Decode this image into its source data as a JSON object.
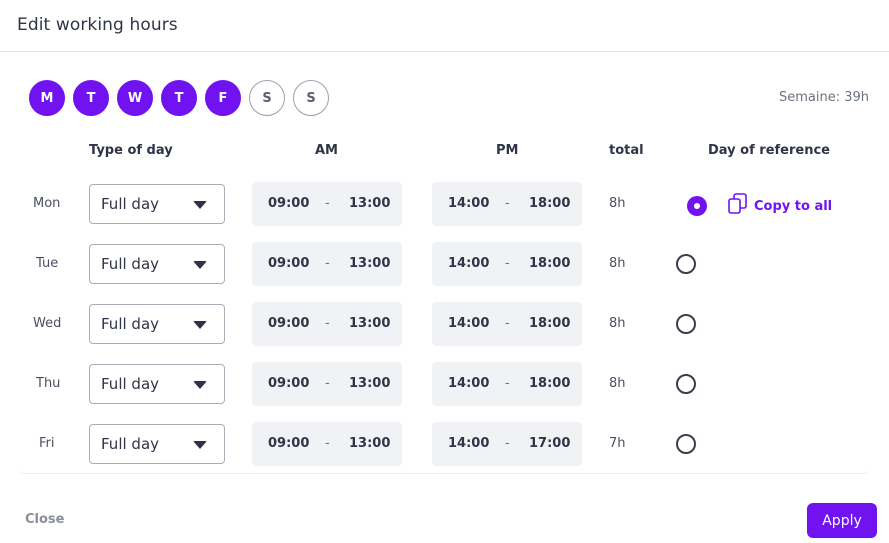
{
  "modal": {
    "title": "Edit working hours"
  },
  "week_days": [
    {
      "letter": "M",
      "active": true
    },
    {
      "letter": "T",
      "active": true
    },
    {
      "letter": "W",
      "active": true
    },
    {
      "letter": "T",
      "active": true
    },
    {
      "letter": "F",
      "active": true
    },
    {
      "letter": "S",
      "active": false
    },
    {
      "letter": "S",
      "active": false
    }
  ],
  "week_total": "Semaine: 39h",
  "columns": {
    "type_of_day": "Type of day",
    "am": "AM",
    "pm": "PM",
    "total": "total",
    "day_of_reference": "Day of reference"
  },
  "rows": [
    {
      "day": "Mon",
      "type": "Full day",
      "am_start": "09:00",
      "am_end": "13:00",
      "pm_start": "14:00",
      "pm_end": "18:00",
      "total": "8h",
      "reference": true
    },
    {
      "day": "Tue",
      "type": "Full day",
      "am_start": "09:00",
      "am_end": "13:00",
      "pm_start": "14:00",
      "pm_end": "18:00",
      "total": "8h",
      "reference": false
    },
    {
      "day": "Wed",
      "type": "Full day",
      "am_start": "09:00",
      "am_end": "13:00",
      "pm_start": "14:00",
      "pm_end": "18:00",
      "total": "8h",
      "reference": false
    },
    {
      "day": "Thu",
      "type": "Full day",
      "am_start": "09:00",
      "am_end": "13:00",
      "pm_start": "14:00",
      "pm_end": "18:00",
      "total": "8h",
      "reference": false
    },
    {
      "day": "Fri",
      "type": "Full day",
      "am_start": "09:00",
      "am_end": "13:00",
      "pm_start": "14:00",
      "pm_end": "17:00",
      "total": "7h",
      "reference": false
    }
  ],
  "time_separator": "-",
  "copy_all_label": "Copy to all",
  "footer": {
    "close_label": "Close",
    "apply_label": "Apply"
  },
  "colors": {
    "accent": "#7013f0",
    "time_bg": "#f1f2f5"
  },
  "icons": {
    "copy": "copy-icon",
    "dropdown": "chevron-down-icon"
  }
}
